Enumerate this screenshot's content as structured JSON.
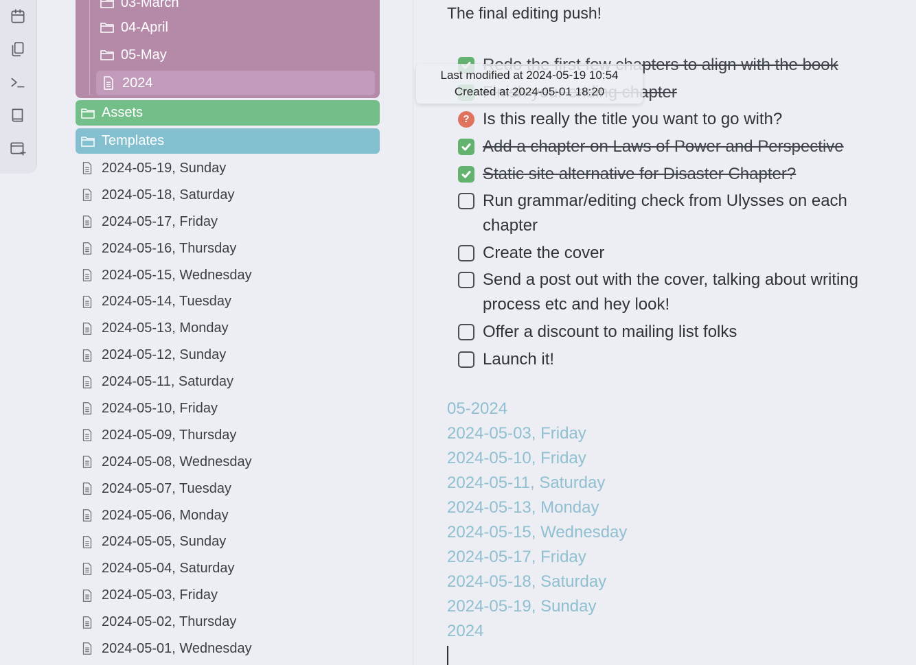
{
  "ribbon": {
    "icons": [
      "calendar-icon",
      "files-icon",
      "terminal-icon",
      "book-icon",
      "new-tab-icon"
    ]
  },
  "sidebar": {
    "subfolders": [
      {
        "label": "03-March",
        "type": "folder"
      },
      {
        "label": "04-April",
        "type": "folder"
      },
      {
        "label": "05-May",
        "type": "folder"
      },
      {
        "label": "2024",
        "type": "file"
      }
    ],
    "assets_label": "Assets",
    "templates_label": "Templates",
    "files": [
      "2024-05-19, Sunday",
      "2024-05-18, Saturday",
      "2024-05-17, Friday",
      "2024-05-16, Thursday",
      "2024-05-15, Wednesday",
      "2024-05-14, Tuesday",
      "2024-05-13, Monday",
      "2024-05-12, Sunday",
      "2024-05-11, Saturday",
      "2024-05-10, Friday",
      "2024-05-09, Thursday",
      "2024-05-08, Wednesday",
      "2024-05-07, Tuesday",
      "2024-05-06, Monday",
      "2024-05-05, Sunday",
      "2024-05-04, Saturday",
      "2024-05-03, Friday",
      "2024-05-02, Thursday",
      "2024-05-01, Wednesday"
    ],
    "colors": {
      "folder_group": "#b58aa8",
      "assets": "#74be89",
      "templates": "#84bfd0"
    }
  },
  "tooltip": {
    "modified": "Last modified at 2024-05-19 10:54",
    "created": "Created at 2024-05-01 18:20"
  },
  "editor": {
    "heading": "The final editing push!",
    "tasks": [
      {
        "text": "Redo the first few chapters to align with the book",
        "state": "done"
      },
      {
        "text": "Finish your ending chapter",
        "state": "done"
      },
      {
        "text": "Is this really the title you want to go with?",
        "state": "question"
      },
      {
        "text": "Add a chapter on Laws of Power and Perspective",
        "state": "done"
      },
      {
        "text": "Static site alternative for Disaster Chapter?",
        "state": "done"
      },
      {
        "text": "Run grammar/editing check from Ulysses on each chapter",
        "state": "open"
      },
      {
        "text": "Create the cover",
        "state": "open"
      },
      {
        "text": "Send a post out with the cover, talking about writing process etc and hey look!",
        "state": "open"
      },
      {
        "text": "Offer a discount to mailing list folks",
        "state": "open"
      },
      {
        "text": "Launch it!",
        "state": "open"
      }
    ],
    "links": [
      "05-2024",
      "2024-05-03, Friday",
      "2024-05-10, Friday",
      "2024-05-11, Saturday",
      "2024-05-13, Monday",
      "2024-05-15, Wednesday",
      "2024-05-17, Friday",
      "2024-05-18, Saturday",
      "2024-05-19, Sunday",
      "2024"
    ],
    "colors": {
      "link": "#8fbfd1",
      "check_done": "#62b36f",
      "question": "#e0735d"
    }
  }
}
